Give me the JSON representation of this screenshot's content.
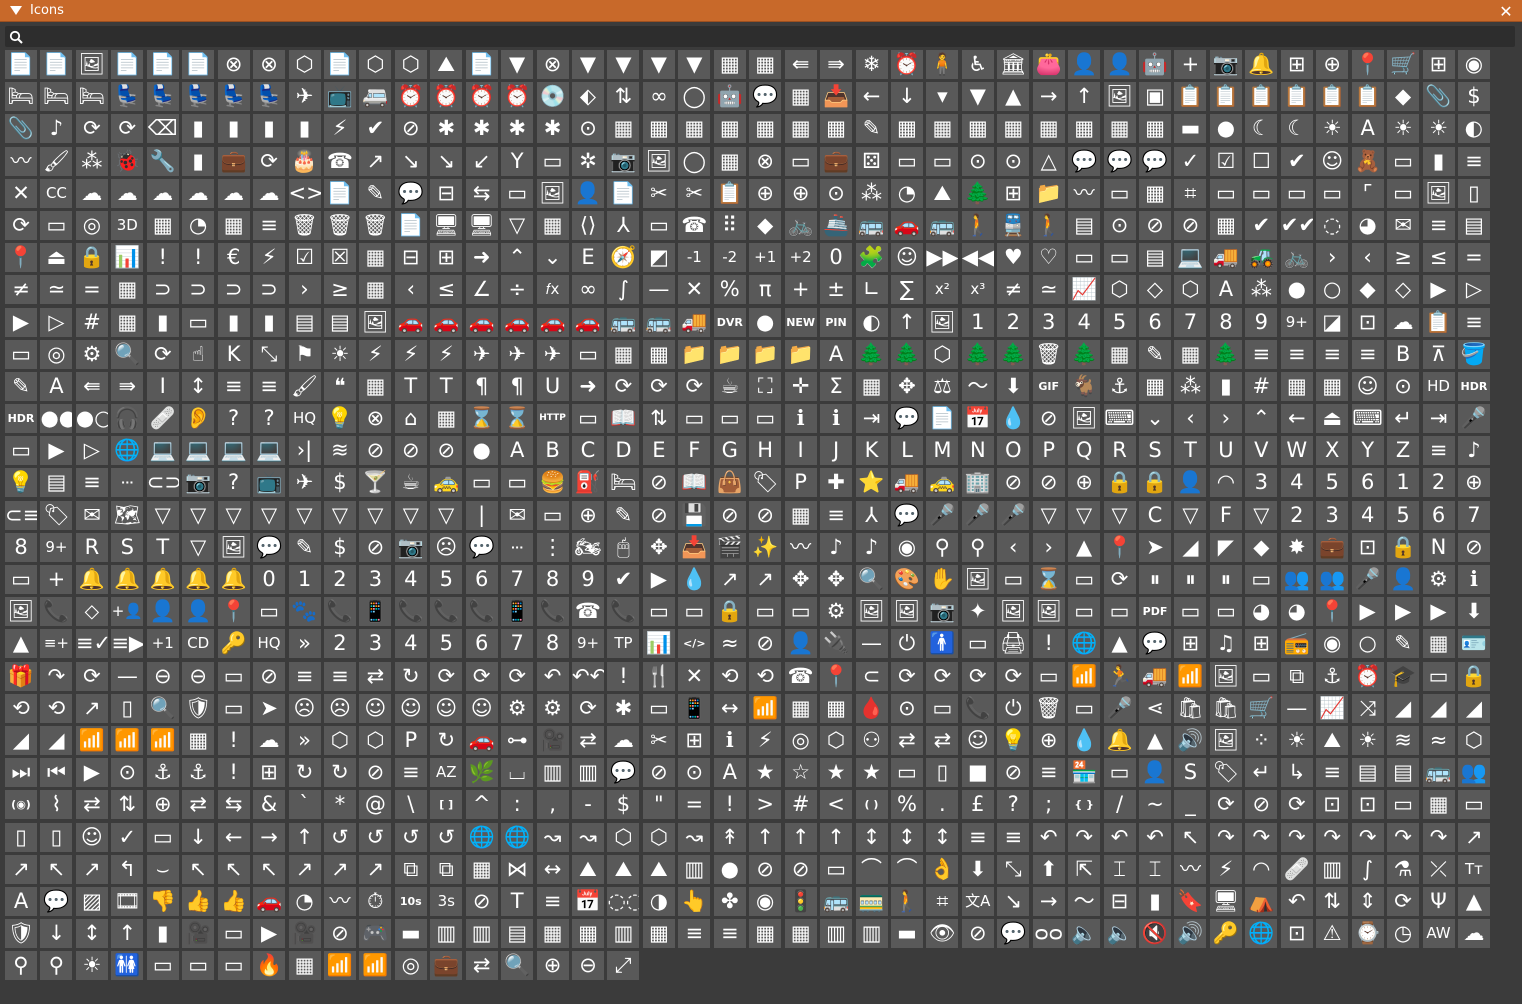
{
  "window": {
    "title": "Icons",
    "close_glyph": "✕",
    "collapse_glyph": "▼"
  },
  "search": {
    "value": "",
    "placeholder": ""
  },
  "grid": {
    "rows": [
      [
        "📄",
        "📄",
        "🖼",
        "📄",
        "📄",
        "📄",
        "⊗",
        "⊗",
        "⬡",
        "📄",
        "⬡",
        "⬡",
        "⛰",
        "📄",
        "▼",
        "⊗",
        "▼",
        "▼",
        "▼",
        "▼",
        "▦",
        "▦",
        "⇚",
        "⇛",
        "❄",
        "⏰",
        "🧍",
        "♿",
        "🏛",
        "👛",
        "👤",
        "👤",
        "🤖",
        "+",
        "📷",
        "🔔",
        "⊞",
        "⊕",
        "📍",
        "🛒",
        "⊞",
        "◉"
      ],
      [
        "🛏",
        "🛏",
        "🛏",
        "💺",
        "💺",
        "💺",
        "💺",
        "💺",
        "✈",
        "📺",
        "🚐",
        "⏰",
        "⏰",
        "⏰",
        "⏰",
        "💿",
        "⬖",
        "⇅",
        "∞",
        "◯",
        "🤖",
        "💬",
        "▦",
        "📥",
        "←",
        "↓",
        "▾",
        "▼",
        "▲",
        "→",
        "↑",
        "🖼",
        "▣",
        "📋",
        "📋",
        "📋",
        "📋",
        "📋",
        "📋",
        "◆",
        "📎",
        "$"
      ],
      [
        "📎",
        "♪",
        "⟳",
        "⟳",
        "⌫",
        "▮",
        "▮",
        "▮",
        "▮",
        "⚡",
        "✔",
        "⊘",
        "✱",
        "✱",
        "✱",
        "✱",
        "⊙",
        "▦",
        "▦",
        "▦",
        "▦",
        "▦",
        "▦",
        "▦",
        "✎",
        "▦",
        "▦",
        "▦",
        "▦",
        "▦",
        "▦",
        "▦",
        "▦",
        "▬",
        "●",
        "☾",
        "☾",
        "☀",
        "A",
        "☀",
        "☀",
        "◐",
        "〰"
      ],
      [
        "🖌",
        "⁂",
        "🐞",
        "🔧",
        "▮",
        "💼",
        "⟳",
        "🎂",
        "☎",
        "↗",
        "↘",
        "↘",
        "↙",
        "Y",
        "▭",
        "✲",
        "📷",
        "🖼",
        "◯",
        "▦",
        "⊗",
        "▭",
        "💼",
        "⚄",
        "▭",
        "▭",
        "⊙",
        "⊙",
        "△",
        "💬",
        "💬",
        "💬",
        "✓",
        "☑",
        "☐",
        "✔",
        "☺",
        "🧸",
        "▭",
        "▮",
        "≡"
      ],
      [
        "✕",
        "CC",
        "☁",
        "☁",
        "☁",
        "☁",
        "☁",
        "☁",
        "<>",
        "📄",
        "✎",
        "💬",
        "⊟",
        "⇆",
        "▭",
        "🖼",
        "👤",
        "📄",
        "✂",
        "✂",
        "📋",
        "⊕",
        "⊕",
        "⊙",
        "⁂",
        "◔",
        "⛰",
        "🌲",
        "⊞",
        "📁",
        "〰",
        "▭",
        "▦",
        "⌗",
        "▭",
        "▭",
        "▭",
        "▭",
        "⌜",
        "▭",
        "🖼",
        "▯"
      ],
      [
        "⟳",
        "▭",
        "◎",
        "3D",
        "▦",
        "◔",
        "▦",
        "≡",
        "🗑",
        "🗑",
        "🗑",
        "📄",
        "🖥",
        "🖥",
        "▽",
        "▦",
        "⟨⟩",
        "⅄",
        "▭",
        "☎",
        "⠿",
        "◆",
        "🚲",
        "🚢",
        "🚌",
        "🚗",
        "🚌",
        "🚶",
        "🚆",
        "🚶",
        "▤",
        "⊙",
        "⊘",
        "⊘",
        "▦",
        "✔",
        "✔✔",
        "◌",
        "◕",
        "✉",
        "≡"
      ],
      [
        "▤",
        "📍",
        "⏏",
        "🔒",
        "📊",
        "!",
        "!",
        "€",
        "⚡",
        "☑",
        "☒",
        "▦",
        "⊟",
        "⊞",
        "➜",
        "⌃",
        "⌄",
        "E",
        "🧭",
        "◩",
        "-1",
        "-2",
        "+1",
        "+2",
        "0",
        "🧩",
        "☺",
        "▶▶",
        "◀◀",
        "♥",
        "♡",
        "▭",
        "▭",
        "▤",
        "💻",
        "🚚",
        "🚜",
        "🚲",
        "›",
        "‹",
        "≥",
        "≤",
        "="
      ],
      [
        "≠",
        "≃",
        "=",
        "▦",
        "⊃",
        "⊃",
        "⊃",
        "⊃",
        "›",
        "≥",
        "▦",
        "‹",
        "≤",
        "∠",
        "÷",
        "𝑓x",
        "∞",
        "∫",
        "—",
        "✕",
        "%",
        "π",
        "+",
        "±",
        "∟",
        "∑",
        "x²",
        "x³",
        "≠",
        "≃",
        "📈",
        "⬡",
        "◇",
        "⬡",
        "A",
        "⁂",
        "●",
        "○",
        "◆",
        "◇",
        "▶",
        "▷"
      ],
      [
        "▶",
        "▷",
        "#",
        "▦",
        "▮",
        "▭",
        "▮",
        "▮",
        "▤",
        "▤",
        "🖼",
        "🚗",
        "🚗",
        "🚗",
        "🚗",
        "🚗",
        "🚗",
        "🚌",
        "🚌",
        "🚚",
        "DVR",
        "●",
        "NEW",
        "PIN",
        "◐",
        "↑",
        "🖼",
        "1",
        "2",
        "3",
        "4",
        "5",
        "6",
        "7",
        "8",
        "9",
        "9+",
        "◪",
        "⊡",
        "☁",
        "📋",
        "≡"
      ],
      [
        "▭",
        "◎",
        "⚙",
        "🔍",
        "⟳",
        "☝",
        "K",
        "⤡",
        "⚑",
        "☀",
        "⚡",
        "⚡",
        "⚡",
        "✈",
        "✈",
        "✈",
        "▭",
        "▦",
        "▦",
        "📁",
        "📁",
        "📁",
        "📁",
        "A",
        "🌲",
        "🌲",
        "⬡",
        "🌲",
        "🌲",
        "🗑",
        "🌲",
        "▦",
        "✎",
        "▦",
        "🌲",
        "≡",
        "≡",
        "≡",
        "≡",
        "B",
        "⊼",
        "🪣"
      ],
      [
        "✎",
        "A",
        "⇚",
        "⇛",
        "I",
        "↕",
        "≡",
        "≡",
        "🖌",
        "❝",
        "▦",
        "T",
        "T",
        "¶",
        "¶",
        "U",
        "➜",
        "⟳",
        "⟳",
        "⟳",
        "☕",
        "⛶",
        "✛",
        "Σ",
        "▦",
        "✥",
        "⚖",
        "〜",
        "⬇",
        "GIF",
        "🐐",
        "⚓",
        "▦",
        "⁂",
        "▮",
        "#",
        "▦",
        "▦",
        "☺",
        "⊙",
        "HD",
        "HDR"
      ],
      [
        "HDR",
        "●●",
        "●○",
        "🎧",
        "🩹",
        "👂",
        "?",
        "?",
        "HQ",
        "💡",
        "⊗",
        "⌂",
        "▦",
        "⌛",
        "⌛",
        "HTTP",
        "▭",
        "📖",
        "⇅",
        "▭",
        "▭",
        "▭",
        "ℹ",
        "ℹ",
        "⇥",
        "💬",
        "📄",
        "📅",
        "💧",
        "⊘",
        "🖼",
        "⌨",
        "⌄",
        "‹",
        "›",
        "⌃",
        "←",
        "⏏",
        "⌨",
        "↵",
        "⇥"
      ],
      [
        "🎤",
        "▭",
        "▶",
        "▷",
        "🌐",
        "💻",
        "💻",
        "💻",
        "💻",
        "›|",
        "≋",
        "⊘",
        "⊘",
        "⊘",
        "●",
        "A",
        "B",
        "C",
        "D",
        "E",
        "F",
        "G",
        "H",
        "I",
        "J",
        "K",
        "L",
        "M",
        "N",
        "O",
        "P",
        "Q",
        "R",
        "S",
        "T",
        "U",
        "V",
        "W",
        "X",
        "Y",
        "Z",
        "≡"
      ],
      [
        "♪",
        "💡",
        "▤",
        "≡",
        "···",
        "⊂⊃",
        "📷",
        "?",
        "📺",
        "✈",
        "$",
        "🍸",
        "☕",
        "🚕",
        "▭",
        "▭",
        "🍔",
        "⛽",
        "🛏",
        "⊘",
        "📖",
        "👜",
        "🏷",
        "P",
        "✚",
        "⭐",
        "🚚",
        "🚕",
        "🏢",
        "⊘",
        "⊘",
        "⊕",
        "🔒",
        "🔒",
        "👤",
        "◠",
        "3",
        "4",
        "5"
      ],
      [
        "6",
        "1",
        "2",
        "⊕",
        "⊂≡",
        "🏷",
        "✉",
        "🗺",
        "▽",
        "▽",
        "▽",
        "▽",
        "▽",
        "▽",
        "▽",
        "▽",
        "▽",
        "|",
        "✉",
        "▭",
        "⊕",
        "✎",
        "⊘",
        "💾",
        "⊘",
        "⊘",
        "▦",
        "≡",
        "⅄",
        "💬",
        "🎤",
        "🎤",
        "🎤",
        "▽",
        "▽",
        "▽",
        "C",
        "▽",
        "F",
        "▽",
        "2",
        "3",
        "4"
      ],
      [
        "5",
        "6",
        "7",
        "8",
        "9+",
        "R",
        "S",
        "T",
        "▽",
        "🖼",
        "💬",
        "✎",
        "$",
        "⊘",
        "📷",
        "☹",
        "💬",
        "···",
        "⋮",
        "🏍",
        "🖱",
        "✥",
        "📥",
        "🎬",
        "✨",
        "〰",
        "♪",
        "♪",
        "◉",
        "⚲",
        "⚲",
        "‹",
        "›",
        "▲",
        "📍",
        "➤",
        "◢",
        "◤",
        "◆",
        "✸",
        "💼"
      ],
      [
        "⊡",
        "🔒",
        "N",
        "⊘",
        "▭",
        "+",
        "🔔",
        "🔔",
        "🔔",
        "🔔",
        "🔔",
        "0",
        "1",
        "2",
        "3",
        "4",
        "5",
        "6",
        "7",
        "8",
        "9",
        "✔",
        "▶",
        "💧",
        "↗",
        "↗",
        "✥",
        "✥",
        "🔍",
        "🎨",
        "✋",
        "🖼",
        "▭",
        "⌛",
        "▭",
        "⟳",
        "⏸",
        "⏸",
        "⏸",
        "▭",
        "👥",
        "👥"
      ],
      [
        "🎤",
        "👤",
        "⚙",
        "ℹ",
        "🖼",
        "📞",
        "⬦",
        "+👤",
        "👤",
        "👤",
        "📍",
        "▭",
        "🐾",
        "📞",
        "📱",
        "📞",
        "📞",
        "📞",
        "📱",
        "📞",
        "☎",
        "📞",
        "▭",
        "▭",
        "🔒",
        "▭",
        "▭",
        "⚙",
        "🖼",
        "🖼",
        "📷",
        "✦",
        "🖼",
        "🖼",
        "▭",
        "▭",
        "PDF",
        "▭",
        "▭",
        "◕",
        "◕"
      ],
      [
        "📍",
        "▶",
        "▶",
        "▶",
        "⬇",
        "▲",
        "≡+",
        "≡✓",
        "≡▶",
        "+1",
        "CD",
        "🔑",
        "HQ",
        "»",
        "2",
        "3",
        "4",
        "5",
        "6",
        "7",
        "8",
        "9+",
        "TP",
        "📊",
        "</>",
        "≈",
        "⊘",
        "👤",
        "🔌",
        "—",
        "⏻",
        "🚹",
        "▭",
        "🖨",
        "!",
        "🌐",
        "▲",
        "💬",
        "⊞",
        "♫",
        "⊞",
        "📻"
      ],
      [
        "◉",
        "○",
        "✎",
        "▦",
        "🪪",
        "🎁",
        "↷",
        "⟳",
        "—",
        "⊖",
        "⊖",
        "▭",
        "⊘",
        "≡",
        "≡",
        "⇄",
        "↻",
        "⟳",
        "⟳",
        "⟳",
        "↶",
        "↶↶",
        "!",
        "🍴",
        "✕",
        "⟲",
        "⟲",
        "☎",
        "📍",
        "⊂",
        "⟳",
        "⟳",
        "⟳",
        "⟳",
        "▭",
        "📶",
        "🏃",
        "🚚",
        "📶",
        "🖼",
        "▭"
      ],
      [
        "⧉",
        "⚓",
        "⏰",
        "🎓",
        "▭",
        "🔒",
        "⟲",
        "⟲",
        "↗",
        "▯",
        "🔍",
        "🛡",
        "▭",
        "➤",
        "☹",
        "☹",
        "☺",
        "☺",
        "☺",
        "☺",
        "⚙",
        "⚙",
        "⟳",
        "✱",
        "▭",
        "📱",
        "↔",
        "📶",
        "▦",
        "▦",
        "🩸",
        "⊙",
        "▭",
        "📞",
        "⏻",
        "🗑",
        "▭",
        "🎤",
        "⋖",
        "🛍",
        "🛍",
        "🛒",
        "—"
      ],
      [
        "📈",
        "⤨",
        "◢",
        "◢",
        "◢",
        "◢",
        "◢",
        "📶",
        "📶",
        "📶",
        "▦",
        "!",
        "☁",
        "»",
        "⬡",
        "⬡",
        "P",
        "↻",
        "🚗",
        "⊶",
        "🎥",
        "⇄",
        "☁",
        "✂",
        "⊞",
        "ℹ",
        "⚡",
        "◎",
        "⬡",
        "⚇",
        "⇄",
        "⇄",
        "☺",
        "💡",
        "⊕",
        "💧",
        "🔔",
        "▲",
        "🔊",
        "🖼",
        "⁘",
        "☀"
      ],
      [
        "⛰",
        "☀",
        "≋",
        "≈",
        "⬡",
        "⏭",
        "⏮",
        "▶",
        "⊙",
        "⚓",
        "⚓",
        "!",
        "⊞",
        "↻",
        "↻",
        "⊘",
        "≡",
        "AZ",
        "🌿",
        "⌴",
        "▥",
        "▥",
        "💬",
        "⊘",
        "⊙",
        "A",
        "★",
        "☆",
        "★",
        "★",
        "▭",
        "▯",
        "■",
        "⊘",
        "≡",
        "🏪",
        "▭",
        "👤",
        "S",
        "🏷",
        "↵",
        "↳"
      ],
      [
        "≡",
        "▤",
        "▤",
        "🚌",
        "👥",
        "(◉)",
        "⌇",
        "⇄",
        "⇅",
        "⊕",
        "⇄",
        "⇆",
        "&",
        "`",
        "*",
        "@",
        "\\",
        "[ ]",
        "^",
        ":",
        ",",
        "-",
        "$",
        "\"",
        "=",
        "!",
        ">",
        "#",
        "<",
        "( )",
        "%",
        ".",
        "£",
        "?",
        ";",
        "{ }",
        "/",
        "~",
        "_",
        "⟳",
        "⊘",
        "⟳"
      ],
      [
        "⊡",
        "⊡",
        "▭",
        "▦",
        "▭",
        "▯",
        "▯",
        "☺",
        "✓",
        "▭",
        "↓",
        "←",
        "→",
        "↑",
        "↺",
        "↺",
        "↺",
        "↺",
        "🌐",
        "🌐",
        "↝",
        "↝",
        "⬡",
        "⬡",
        "↝",
        "↟",
        "↑",
        "↑",
        "↑",
        "↕",
        "↕",
        "↕",
        "≡",
        "≡",
        "↶",
        "↷",
        "↶",
        "↶"
      ],
      [
        "↖",
        "↷",
        "↷",
        "↷",
        "↷",
        "↷",
        "↷",
        "↷",
        "↗",
        "↗",
        "↖",
        "↗",
        "↰",
        "⌣",
        "↖",
        "↖",
        "↖",
        "↗",
        "↗",
        "↗",
        "⧉",
        "⧉",
        "▦",
        "⋈",
        "↔",
        "⛰",
        "⛰",
        "⛰",
        "▥",
        "●",
        "⊘",
        "⊘",
        "▭",
        "⌒",
        "⌒",
        "👌",
        "⬇",
        "⤡",
        "⬆",
        "⇱",
        "⌶",
        "⌶"
      ],
      [
        "〰",
        "⚡",
        "◠",
        "🩹",
        "▥",
        "∫",
        "⚗",
        "⤫",
        "Tт",
        "A",
        "💬",
        "▨",
        "🎞",
        "👎",
        "👍",
        "👍",
        "🚗",
        "◔",
        "〰",
        "⏱",
        "10s",
        "3s",
        "⊘",
        "T",
        "≡",
        "📅",
        "◌◌",
        "◑",
        "👆",
        "✤",
        "◉",
        "🚦",
        "🚌",
        "🚃",
        "🚶",
        "⌗",
        "文A",
        "↘",
        "→",
        "〜",
        "⊟",
        "▮"
      ],
      [
        "🔖",
        "🖥",
        "⛺",
        "↶",
        "⇅",
        "⇕",
        "⟳",
        "Ψ",
        "▲",
        "🛡",
        "↓",
        "↕",
        "↑",
        "▮",
        "🎥",
        "▭",
        "▶",
        "🎥",
        "⊘",
        "🎮",
        "▬",
        "▥",
        "▥",
        "▤",
        "▦",
        "▦",
        "▥",
        "▦",
        "≡",
        "≡",
        "▦",
        "▦",
        "▥",
        "▥",
        "▬",
        "👁",
        "⊘",
        "💬",
        "ᴑᴑ",
        "🔈",
        "🔈",
        "🔇",
        "🔊"
      ],
      [
        "🔑",
        "🌐",
        "⊡",
        "⚠",
        "⌚",
        "◷",
        "AW",
        "☁",
        "⚲",
        "⚲",
        "☀",
        "🚻",
        "▭",
        "▭",
        "▭",
        "🔥",
        "▦",
        "📶",
        "📶",
        "◎",
        "💼",
        "⇄",
        "🔍",
        "⊕",
        "⊖",
        "⤢"
      ]
    ]
  }
}
